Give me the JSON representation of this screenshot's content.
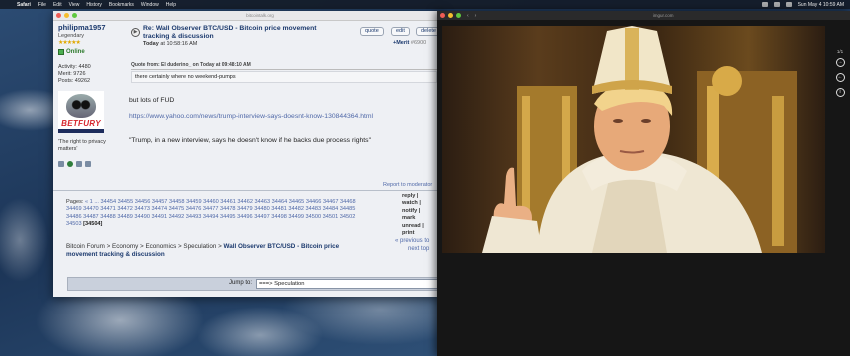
{
  "menubar": {
    "items": [
      "Safari",
      "File",
      "Edit",
      "View",
      "History",
      "Bookmarks",
      "Window",
      "Help"
    ],
    "clock": "Sun May 4 10:59 AM"
  },
  "forum_window": {
    "url": "bitcointalk.org",
    "user": {
      "name": "philipma1957",
      "rank": "Legendary",
      "stars": "★★★★★",
      "status": "Online",
      "activity": "Activity: 4480",
      "merit": "Merit: 9726",
      "posts": "Posts: 49262",
      "avatar_brand": "BETFURY",
      "personal_text": "'The right to privacy matters'"
    },
    "post": {
      "title": "Re: Wall Observer BTC/USD - Bitcoin price movement tracking & discussion",
      "date_label": "Today",
      "date_time": "at 10:58:16 AM",
      "quote_button": "quote",
      "edit_button": "edit",
      "delete_button": "delete",
      "merit_label": "+Merit",
      "post_number": "#6900",
      "quote_header": "Quote from: El duderino_ on Today at 09:48:10 AM",
      "quote_text": "there certainly where no weekend-pumps",
      "body_line1": "but lots of FUD",
      "link": "https://www.yahoo.com/news/trump-interview-says-doesnt-know-130844364.html",
      "body_line2": "\"Trump, in a new interview, says he doesn't know if he backs due process rights\"",
      "report": "Report to moderator"
    },
    "pages": {
      "label": "Pages:",
      "numbers": "« 1 ... 34454 34455 34456 34457 34458 34459 34460 34461 34462 34463 34464 34465 34466 34467 34468 34469 34470 34471 34472 34473 34474 34475 34476 34477 34478 34479 34480 34481 34482 34483 34484 34485 34486 34487 34488 34489 34490 34491 34492 34493 34494 34495 34496 34497 34498 34499 34500 34501 34502 34503",
      "current": "[34504]"
    },
    "actions": [
      "reply |",
      "watch |",
      "notify |",
      "mark unread |",
      "print"
    ],
    "prev": "« previous to",
    "next": "next top",
    "breadcrumb": {
      "path": "Bitcoin Forum > Economy > Economics > Speculation >",
      "current": "Wall Observer BTC/USD - Bitcoin price movement tracking & discussion"
    },
    "jump": {
      "label": "Jump to:",
      "value": "===> Speculation"
    }
  },
  "viewer_window": {
    "url": "imgur.com",
    "counter": "1/1"
  }
}
